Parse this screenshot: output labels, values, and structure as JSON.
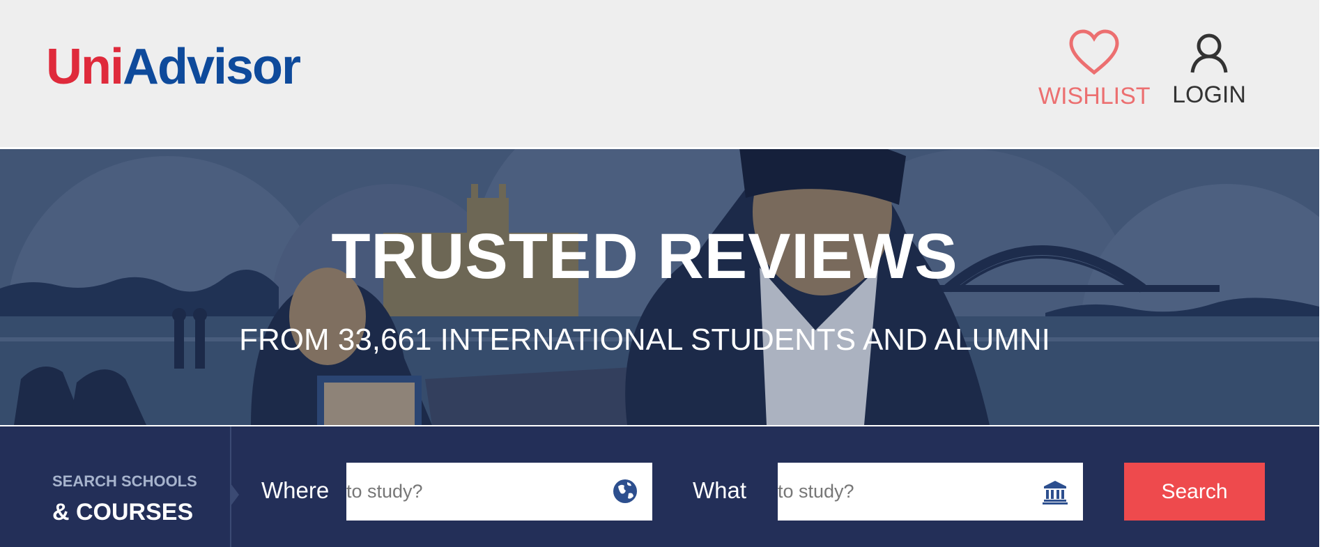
{
  "header": {
    "logo": {
      "part1": "Uni",
      "part2": "Advisor"
    },
    "nav": {
      "wishlist_label": "WISHLIST",
      "login_label": "LOGIN"
    }
  },
  "hero": {
    "title": "TRUSTED REVIEWS",
    "subtitle": "FROM 33,661 INTERNATIONAL STUDENTS AND ALUMNI"
  },
  "search": {
    "section_label_top": "SEARCH SCHOOLS",
    "section_label_bottom": "& COURSES",
    "where_label": "Where",
    "where_placeholder": "to study?",
    "where_icon": "globe-icon",
    "what_label": "What",
    "what_placeholder": "to study?",
    "what_icon": "university-icon",
    "button_label": "Search"
  },
  "colors": {
    "logo_red": "#df2a3b",
    "logo_blue": "#0e4a9b",
    "wishlist": "#ec6f70",
    "search_bar": "#232f58",
    "search_button": "#ee4a4d"
  }
}
